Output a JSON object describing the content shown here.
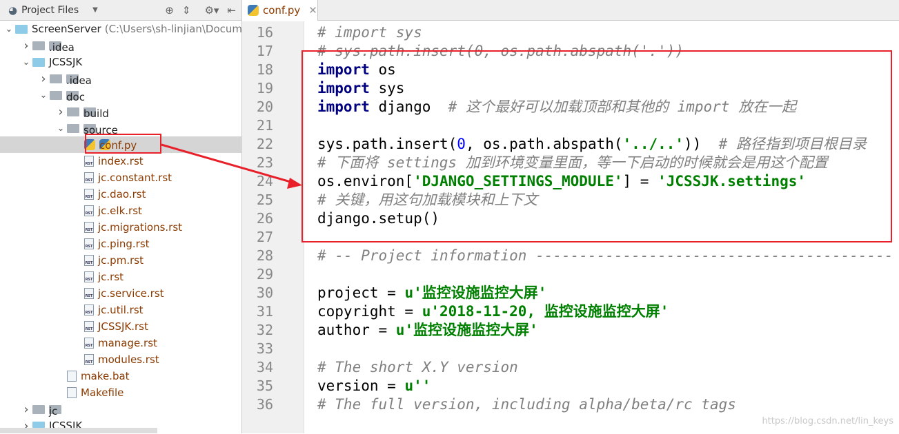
{
  "sidebar": {
    "title": "Project Files",
    "items": [
      {
        "label": "ScreenServer",
        "hint": "(C:\\Users\\sh-linjian\\Docum",
        "level": 0,
        "type": "folder-blue",
        "expanded": true
      },
      {
        "label": ".idea",
        "level": 1,
        "type": "folder",
        "expanded": false
      },
      {
        "label": "JCSSJK",
        "level": 1,
        "type": "folder-blue",
        "expanded": true
      },
      {
        "label": ".idea",
        "level": 2,
        "type": "folder",
        "expanded": false
      },
      {
        "label": "doc",
        "level": 2,
        "type": "folder",
        "expanded": true
      },
      {
        "label": "build",
        "level": 3,
        "type": "folder",
        "expanded": false
      },
      {
        "label": "source",
        "level": 3,
        "type": "folder",
        "expanded": true
      },
      {
        "label": "conf.py",
        "level": 4,
        "type": "py",
        "selected": true
      },
      {
        "label": "index.rst",
        "level": 4,
        "type": "rst"
      },
      {
        "label": "jc.constant.rst",
        "level": 4,
        "type": "rst"
      },
      {
        "label": "jc.dao.rst",
        "level": 4,
        "type": "rst"
      },
      {
        "label": "jc.elk.rst",
        "level": 4,
        "type": "rst"
      },
      {
        "label": "jc.migrations.rst",
        "level": 4,
        "type": "rst"
      },
      {
        "label": "jc.ping.rst",
        "level": 4,
        "type": "rst"
      },
      {
        "label": "jc.pm.rst",
        "level": 4,
        "type": "rst"
      },
      {
        "label": "jc.rst",
        "level": 4,
        "type": "rst"
      },
      {
        "label": "jc.service.rst",
        "level": 4,
        "type": "rst"
      },
      {
        "label": "jc.util.rst",
        "level": 4,
        "type": "rst"
      },
      {
        "label": "JCSSJK.rst",
        "level": 4,
        "type": "rst"
      },
      {
        "label": "manage.rst",
        "level": 4,
        "type": "rst"
      },
      {
        "label": "modules.rst",
        "level": 4,
        "type": "rst"
      },
      {
        "label": "make.bat",
        "level": 3,
        "type": "mk"
      },
      {
        "label": "Makefile",
        "level": 3,
        "type": "mk"
      },
      {
        "label": "jc",
        "level": 1,
        "type": "folder",
        "expanded": false
      },
      {
        "label": "JCSSJK",
        "level": 1,
        "type": "folder-blue",
        "expanded": false
      }
    ]
  },
  "tab": {
    "label": "conf.py"
  },
  "editor": {
    "lines": [
      {
        "n": "16",
        "t": [
          [
            "# import sys",
            "cm"
          ]
        ]
      },
      {
        "n": "17",
        "t": [
          [
            "# sys.path.insert(0, os.path.abspath('.'))",
            "cm"
          ]
        ]
      },
      {
        "n": "18",
        "t": [
          [
            "import",
            "kw"
          ],
          [
            " os",
            ""
          ]
        ]
      },
      {
        "n": "19",
        "t": [
          [
            "import",
            "kw"
          ],
          [
            " sys",
            ""
          ]
        ]
      },
      {
        "n": "20",
        "t": [
          [
            "import",
            "kw"
          ],
          [
            " django  ",
            ""
          ],
          [
            "# 这个最好可以加载顶部和其他的 import 放在一起",
            "cm"
          ]
        ]
      },
      {
        "n": "21",
        "t": []
      },
      {
        "n": "22",
        "t": [
          [
            "sys.path.insert(",
            ""
          ],
          [
            "0",
            "num"
          ],
          [
            ", os.path.abspath(",
            ""
          ],
          [
            "'../..'",
            "str"
          ],
          [
            "))  ",
            ""
          ],
          [
            "# 路径指到项目根目录",
            "cm"
          ]
        ]
      },
      {
        "n": "23",
        "t": [
          [
            "# 下面将 settings 加到环境变量里面，等一下启动的时候就会是用这个配置",
            "cm"
          ]
        ]
      },
      {
        "n": "24",
        "t": [
          [
            "os.environ[",
            ""
          ],
          [
            "'DJANGO_SETTINGS_MODULE'",
            "str"
          ],
          [
            "] = ",
            ""
          ],
          [
            "'JCSSJK.settings'",
            "str"
          ]
        ]
      },
      {
        "n": "25",
        "t": [
          [
            "# 关键，用这句加载模块和上下文",
            "cm"
          ]
        ]
      },
      {
        "n": "26",
        "t": [
          [
            "django.setup()",
            ""
          ]
        ]
      },
      {
        "n": "27",
        "t": []
      },
      {
        "n": "28",
        "t": [
          [
            "# -- Project information -----------------------------------------",
            "cm"
          ]
        ]
      },
      {
        "n": "29",
        "t": []
      },
      {
        "n": "30",
        "t": [
          [
            "project = ",
            ""
          ],
          [
            "u'监控设施监控大屏'",
            "str"
          ]
        ]
      },
      {
        "n": "31",
        "t": [
          [
            "copyright = ",
            ""
          ],
          [
            "u'2018-11-20, 监控设施监控大屏'",
            "str"
          ]
        ]
      },
      {
        "n": "32",
        "t": [
          [
            "author = ",
            ""
          ],
          [
            "u'监控设施监控大屏'",
            "str"
          ]
        ]
      },
      {
        "n": "33",
        "t": []
      },
      {
        "n": "34",
        "t": [
          [
            "# The short X.Y version",
            "cm"
          ]
        ]
      },
      {
        "n": "35",
        "t": [
          [
            "version = ",
            ""
          ],
          [
            "u''",
            "str"
          ]
        ]
      },
      {
        "n": "36",
        "t": [
          [
            "# The full version, including alpha/beta/rc tags",
            "cm"
          ]
        ]
      }
    ]
  },
  "annotation_color": "#e8202a",
  "watermark": "https://blog.csdn.net/lin_keys"
}
